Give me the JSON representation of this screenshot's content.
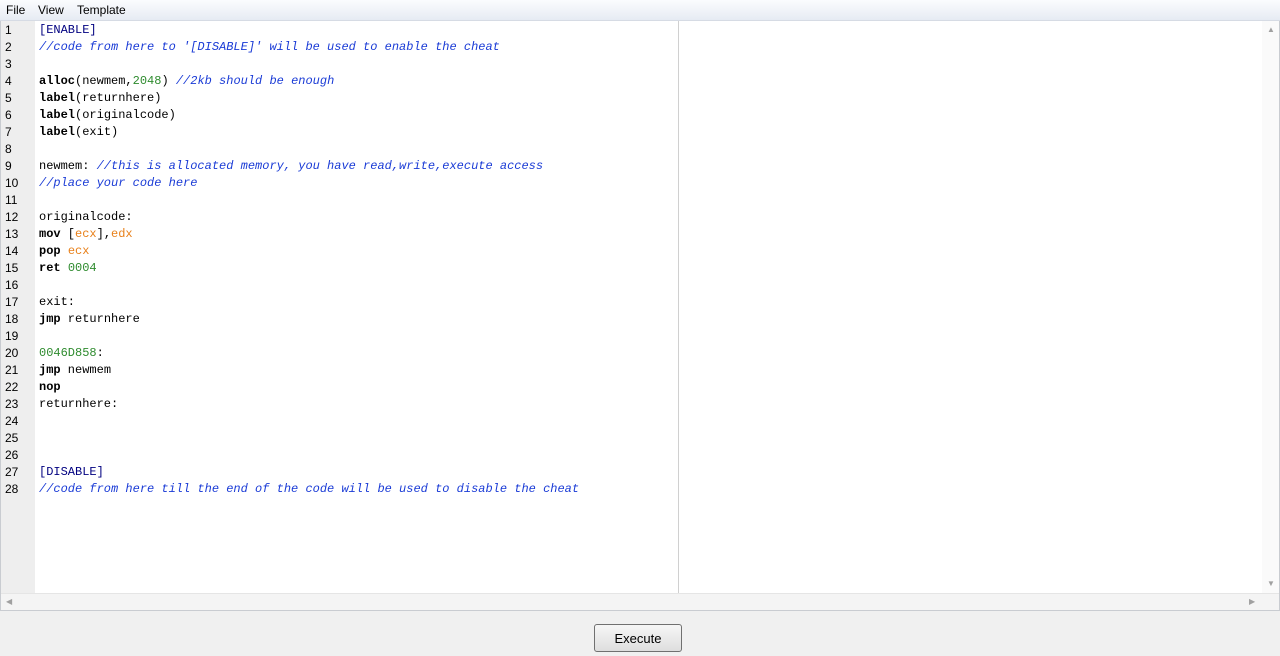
{
  "menu": {
    "file": "File",
    "view": "View",
    "template": "Template"
  },
  "editor": {
    "line_numbers": [
      "1",
      "2",
      "3",
      "4",
      "5",
      "6",
      "7",
      "8",
      "9",
      "10",
      "11",
      "12",
      "13",
      "14",
      "15",
      "16",
      "17",
      "18",
      "19",
      "20",
      "21",
      "22",
      "23",
      "24",
      "25",
      "26",
      "27",
      "28"
    ],
    "lines": [
      [
        {
          "t": "[ENABLE]",
          "c": "sec"
        }
      ],
      [
        {
          "t": "//code from here to '[DISABLE]' will be used to enable the cheat",
          "c": "cm"
        }
      ],
      [],
      [
        {
          "t": "alloc",
          "c": "kw"
        },
        {
          "t": "(newmem,"
        },
        {
          "t": "2048",
          "c": "num"
        },
        {
          "t": ") "
        },
        {
          "t": "//2kb should be enough",
          "c": "cm"
        }
      ],
      [
        {
          "t": "label",
          "c": "kw"
        },
        {
          "t": "(returnhere)"
        }
      ],
      [
        {
          "t": "label",
          "c": "kw"
        },
        {
          "t": "(originalcode)"
        }
      ],
      [
        {
          "t": "label",
          "c": "kw"
        },
        {
          "t": "(exit)"
        }
      ],
      [],
      [
        {
          "t": "newmem: "
        },
        {
          "t": "//this is allocated memory, you have read,write,execute access",
          "c": "cm"
        }
      ],
      [
        {
          "t": "//place your code here",
          "c": "cm"
        }
      ],
      [],
      [
        {
          "t": "originalcode:"
        }
      ],
      [
        {
          "t": "mov",
          "c": "kw"
        },
        {
          "t": " ["
        },
        {
          "t": "ecx",
          "c": "reg"
        },
        {
          "t": "],"
        },
        {
          "t": "edx",
          "c": "reg"
        }
      ],
      [
        {
          "t": "pop",
          "c": "kw"
        },
        {
          "t": " "
        },
        {
          "t": "ecx",
          "c": "reg"
        }
      ],
      [
        {
          "t": "ret",
          "c": "kw"
        },
        {
          "t": " "
        },
        {
          "t": "0004",
          "c": "num"
        }
      ],
      [],
      [
        {
          "t": "exit:"
        }
      ],
      [
        {
          "t": "jmp",
          "c": "kw"
        },
        {
          "t": " returnhere"
        }
      ],
      [],
      [
        {
          "t": "0046D858",
          "c": "num"
        },
        {
          "t": ":"
        }
      ],
      [
        {
          "t": "jmp",
          "c": "kw"
        },
        {
          "t": " newmem"
        }
      ],
      [
        {
          "t": "nop",
          "c": "kw"
        }
      ],
      [
        {
          "t": "returnhere:"
        }
      ],
      [],
      [],
      [],
      [
        {
          "t": "[DISABLE]",
          "c": "sec"
        }
      ],
      [
        {
          "t": "//code from here till the end of the code will be used to disable the cheat",
          "c": "cm"
        }
      ]
    ]
  },
  "execute_label": "Execute",
  "colors": {
    "comment": "#1a3bd6",
    "number": "#2e8b2e",
    "register": "#e8801a",
    "section": "#000080"
  }
}
